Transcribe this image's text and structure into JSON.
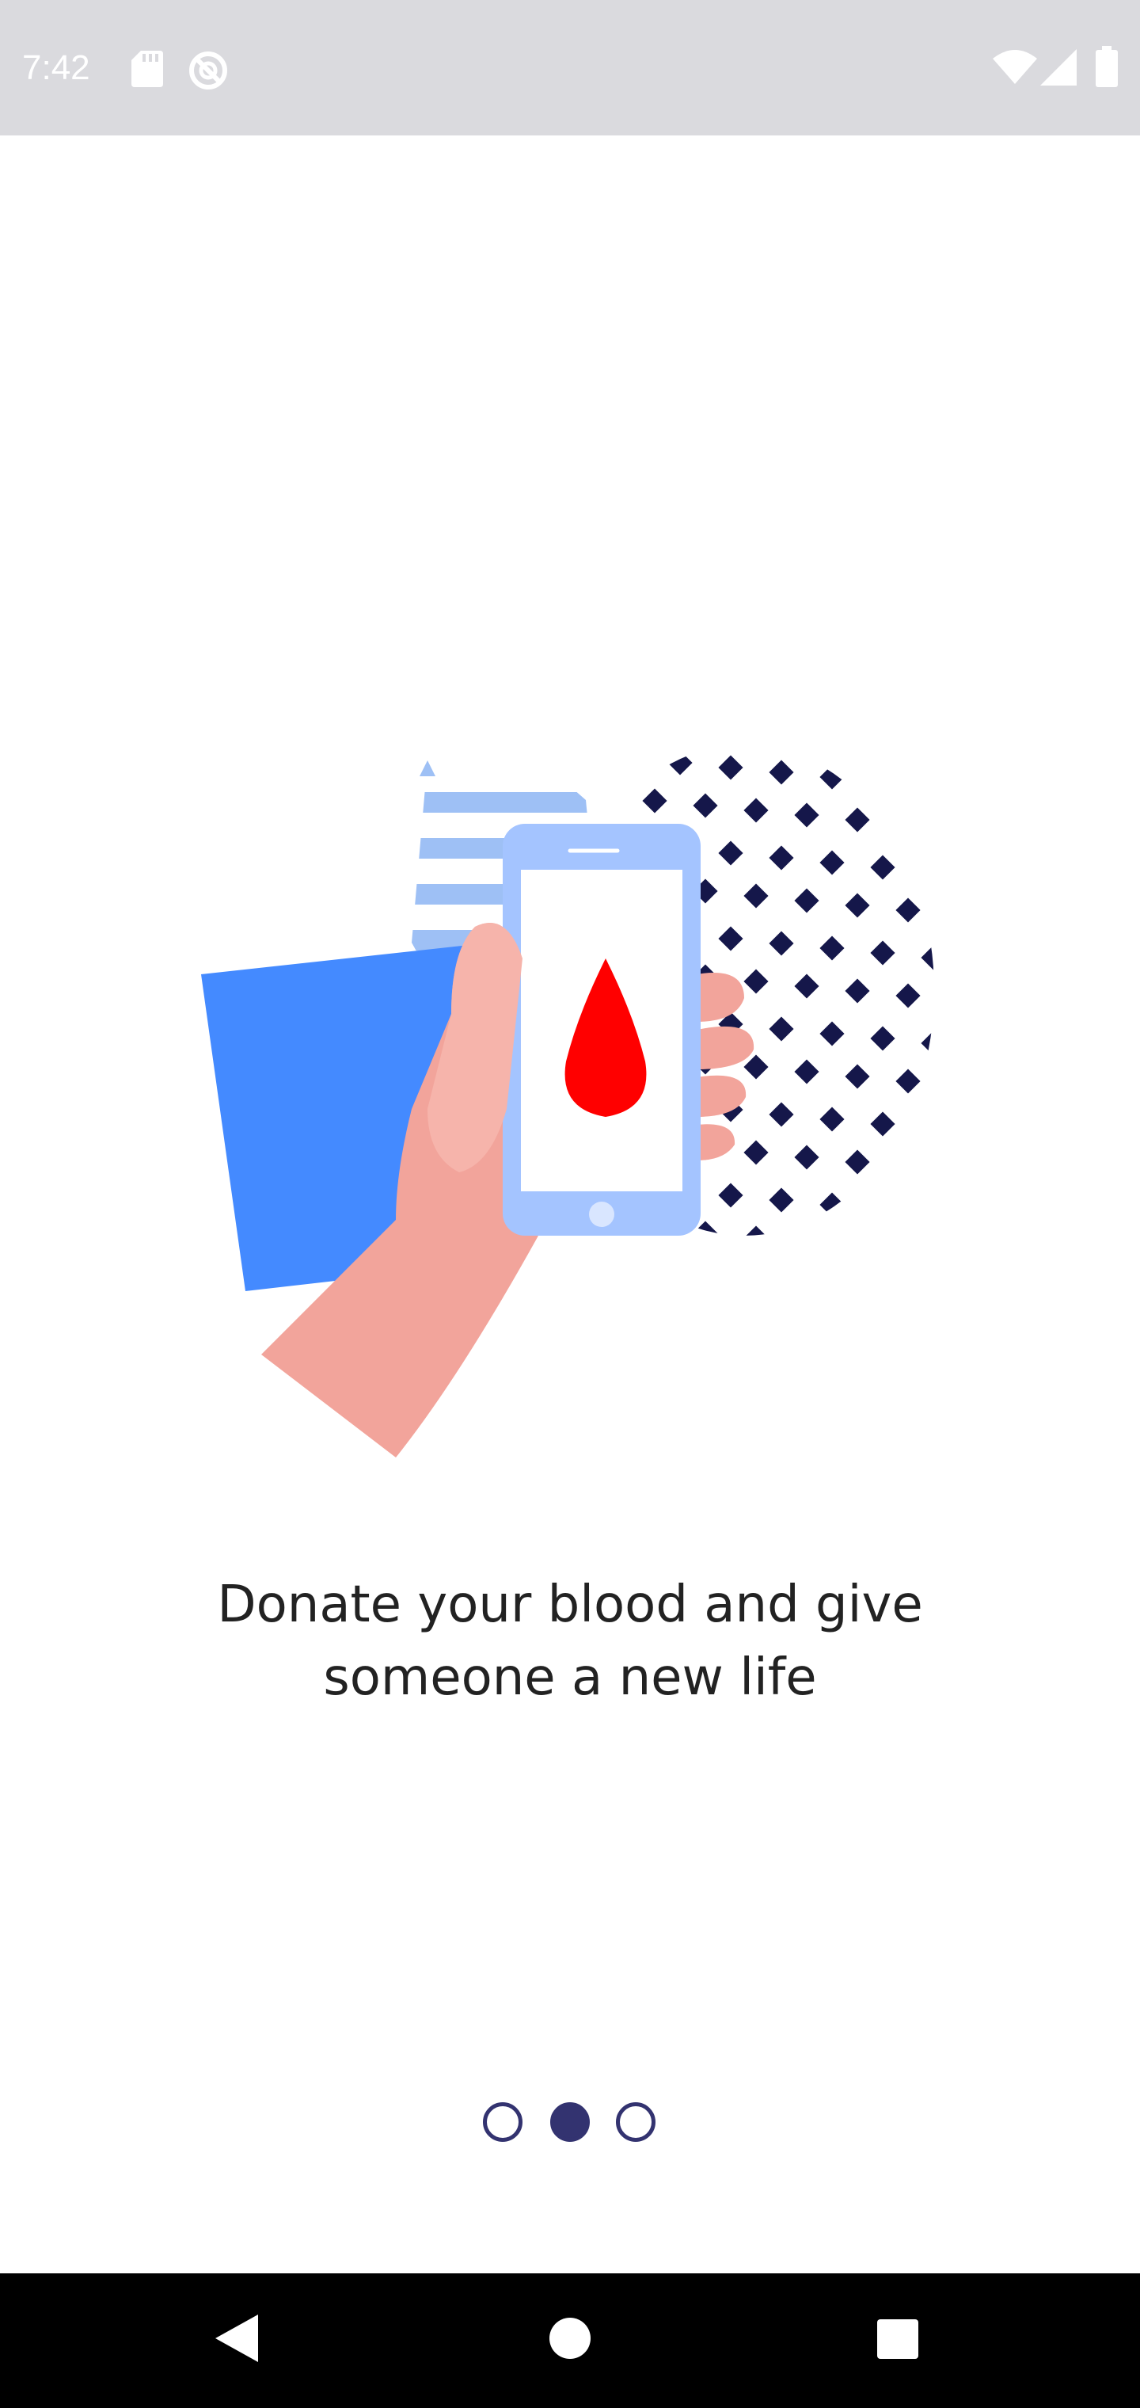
{
  "status_bar": {
    "time": "7:42",
    "icons": [
      "sd-card-icon",
      "sync-disabled-icon",
      "wifi-icon",
      "signal-icon",
      "battery-icon"
    ]
  },
  "onboarding": {
    "text_line1": "Donate your blood and give",
    "text_line2": "someone a new life",
    "illustration": "hand-holding-phone-blood-drop-icon"
  },
  "pager": {
    "page_count": 3,
    "active_index": 1
  },
  "nav_bar": {
    "buttons": [
      "back-icon",
      "home-icon",
      "recents-icon"
    ]
  },
  "colors": {
    "status_bar_bg": "#dadade",
    "accent_dark": "#333370",
    "blood_red": "#ff0000",
    "blue_paper": "#448aff",
    "light_blue": "#a4c4ff",
    "skin": "#f2a49b"
  }
}
